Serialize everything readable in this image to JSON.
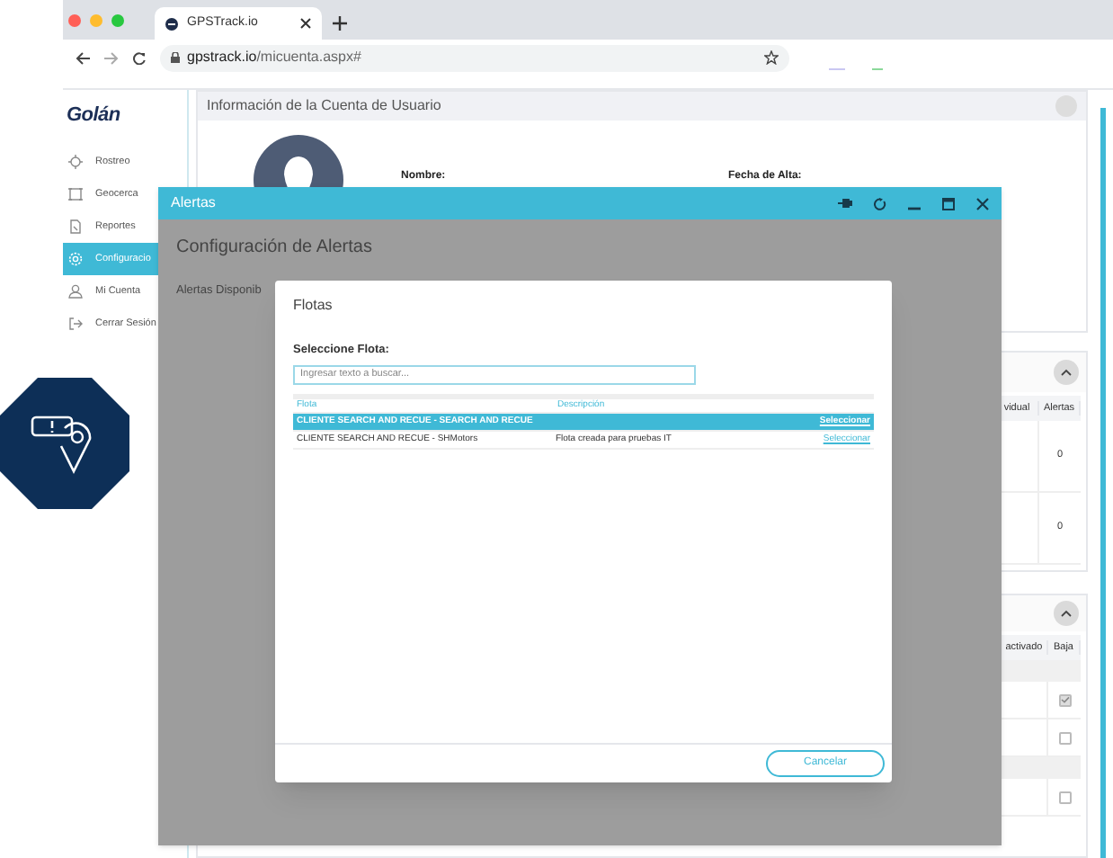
{
  "browser": {
    "tab_title": "GPSTrack.io",
    "url_host": "gpstrack.io",
    "url_path": "/micuenta.aspx#"
  },
  "sidebar": {
    "logo": "Golán",
    "items": [
      {
        "label": "Rostreo",
        "selected": false
      },
      {
        "label": "Geocerca",
        "selected": false
      },
      {
        "label": "Reportes",
        "selected": false
      },
      {
        "label": "Configuracio",
        "selected": true
      },
      {
        "label": "Mi Cuenta",
        "selected": false
      },
      {
        "label": "Cerrar Sesión",
        "selected": false
      }
    ]
  },
  "account_panel": {
    "title": "Información de la Cuenta de Usuario",
    "fields": [
      "Nombre:",
      "Fecha de Alta:"
    ]
  },
  "panel_2": {
    "columns": [
      "vidual",
      "Alertas"
    ],
    "rows": [
      "0",
      "0"
    ]
  },
  "panel_3": {
    "columns": [
      "activado",
      "Baja"
    ],
    "rows": [
      {
        "kind": "group"
      },
      {
        "kind": "item",
        "checked": true
      },
      {
        "kind": "item",
        "checked": false
      },
      {
        "kind": "group"
      },
      {
        "kind": "item",
        "checked": false
      }
    ]
  },
  "alert_window": {
    "title": "Alertas",
    "heading": "Configuración de Alertas",
    "subtitle": "Alertas Disponib"
  },
  "fleet_dialog": {
    "title": "Flotas",
    "prompt": "Seleccione Flota:",
    "search": {
      "placeholder": "Ingresar texto a buscar..."
    },
    "columns": [
      "Flota",
      "Descripción"
    ],
    "rows": [
      {
        "flota": "CLIENTE SEARCH AND RECUE - SEARCH AND RECUE",
        "descripcion": "",
        "action": "Seleccionar",
        "selected": true
      },
      {
        "flota": "CLIENTE SEARCH AND RECUE - SHMotors",
        "descripcion": "Flota creada para pruebas IT",
        "action": "Seleccionar",
        "selected": false
      }
    ],
    "cancel_button": "Cancelar"
  }
}
